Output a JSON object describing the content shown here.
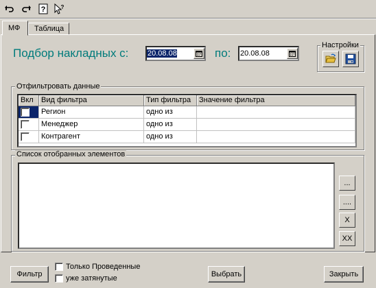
{
  "toolbar": {
    "items": [
      {
        "icon": "undo-arrow-icon"
      },
      {
        "icon": "redo-arrow-icon"
      },
      {
        "icon": "help-icon"
      },
      {
        "icon": "context-help-cursor-icon"
      }
    ]
  },
  "tabs": [
    {
      "label": "МФ",
      "active": true
    },
    {
      "label": "Таблица",
      "active": false
    }
  ],
  "header": {
    "title_from": "Подбор накладных с:",
    "date_from": "20.08.08",
    "title_to": "по:",
    "date_to": "20.08.08"
  },
  "settings": {
    "label": "Настройки",
    "open_icon": "open-folder-icon",
    "save_icon": "floppy-save-icon"
  },
  "filter_group": {
    "title": "Отфильтровать данные",
    "columns": [
      "Вкл",
      "Вид фильтра",
      "Тип фильтра",
      "Значение фильтра"
    ],
    "rows": [
      {
        "enabled": false,
        "kind": "Регион",
        "type": "одно из",
        "value": ""
      },
      {
        "enabled": false,
        "kind": "Менеджер",
        "type": "одно из",
        "value": ""
      },
      {
        "enabled": false,
        "kind": "Контрагент",
        "type": "одно из",
        "value": ""
      }
    ]
  },
  "selected_group": {
    "title": "Список отобранных элементов",
    "buttons": [
      "...",
      "....",
      "X",
      "XX"
    ]
  },
  "footer": {
    "filter_button": "Фильтр",
    "only_posted": "Только Проведенные",
    "already_pulled": "уже затянутые",
    "select_button": "Выбрать",
    "close_button": "Закрыть"
  }
}
